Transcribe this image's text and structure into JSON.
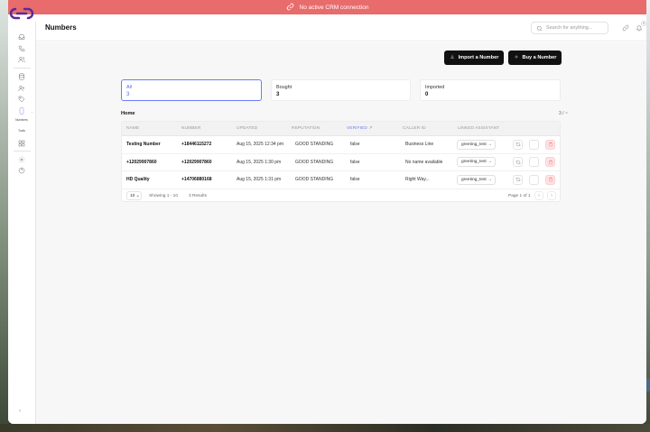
{
  "banner": {
    "text": "No active CRM connection"
  },
  "header": {
    "title": "Numbers",
    "search_placeholder": "Search for anything...",
    "notification_count": "0"
  },
  "sidebar": {
    "numbers_label": "Numbers",
    "tools_label": "Tools"
  },
  "actions": {
    "import_label": "Import a Number",
    "buy_label": "Buy a Number"
  },
  "filters": [
    {
      "label": "All",
      "count": "3"
    },
    {
      "label": "Bought",
      "count": "3"
    },
    {
      "label": "Imported",
      "count": "0"
    }
  ],
  "section": {
    "title": "Home",
    "pager": "3 / ~"
  },
  "table": {
    "columns": [
      "NAME",
      "NUMBER",
      "UPDATED",
      "REPUTATION",
      "VERIFIED",
      "CALLER ID",
      "LINKED ASSISTANT"
    ],
    "rows": [
      {
        "name": "Testing Number",
        "number": "+18446115272",
        "updated": "Aug 15, 2025 12:34 pm",
        "reputation": "GOOD STANDING",
        "verified": "false",
        "caller_id": "Business Line",
        "assistant": "greeting_test"
      },
      {
        "name": "+12029907860",
        "number": "+12029907860",
        "updated": "Aug 15, 2025 1:30 pm",
        "reputation": "GOOD STANDING",
        "verified": "false",
        "caller_id": "No name available",
        "assistant": "greeting_test"
      },
      {
        "name": "HD Quality",
        "number": "+14706880168",
        "updated": "Aug 15, 2025 1:31 pm",
        "reputation": "GOOD STANDING",
        "verified": "false",
        "caller_id": "Right Way...",
        "assistant": "greeting_test"
      }
    ],
    "footer": {
      "page_size": "10",
      "showing": "Showing 1 - 10",
      "results": "3 Results",
      "page": "Page 1 of 1"
    }
  },
  "colors": {
    "banner": "#e86c6c",
    "accent": "#6b7cf5",
    "primary_button": "#111111",
    "delete": "#e15a5a"
  }
}
